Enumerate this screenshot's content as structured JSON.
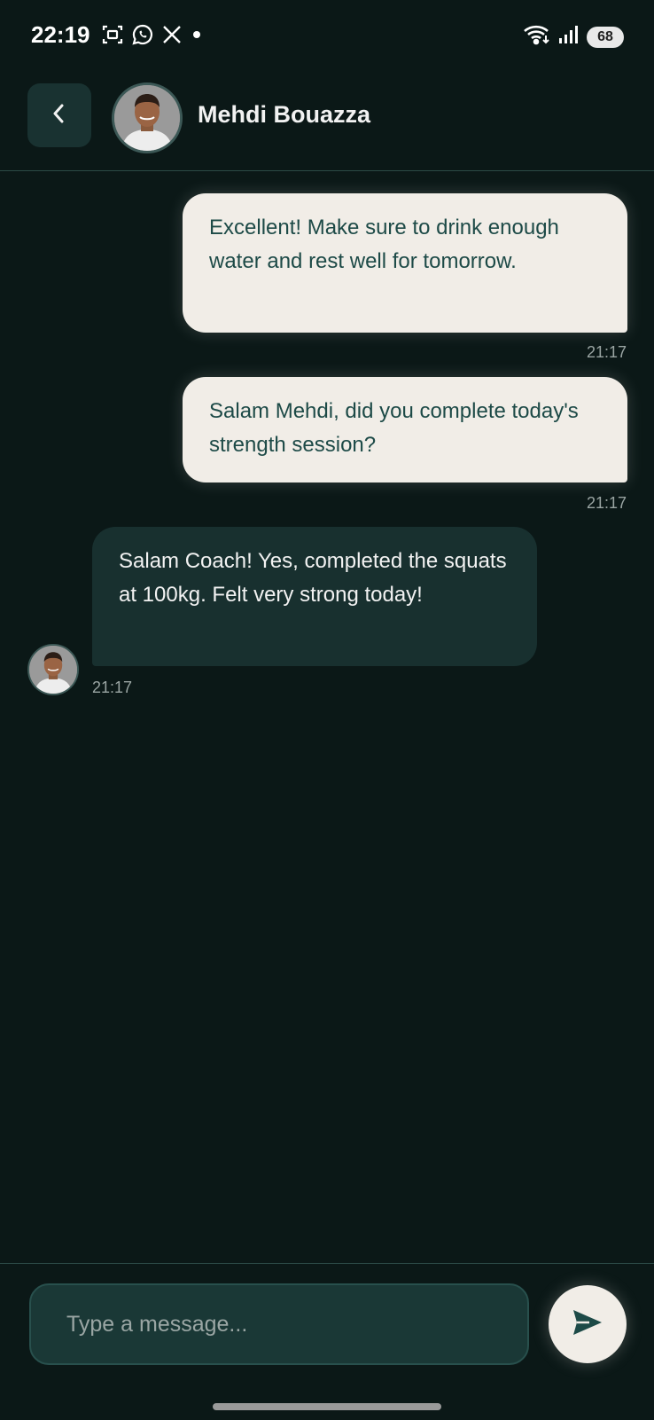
{
  "status_bar": {
    "time": "22:19",
    "notification_icons": [
      "screenshot-icon",
      "whatsapp-icon",
      "x-icon",
      "dot-icon"
    ],
    "system_icons": [
      "wifi-icon",
      "signal-icon"
    ],
    "battery": "68"
  },
  "header": {
    "back_icon": "chevron-left-icon",
    "contact_name": "Mehdi Bouazza"
  },
  "messages": [
    {
      "direction": "outgoing",
      "text": "Excellent! Make sure to drink enough water and rest well for tomorrow.",
      "time": "21:17"
    },
    {
      "direction": "outgoing",
      "text": "Salam Mehdi, did you complete today's strength session?",
      "time": "21:17"
    },
    {
      "direction": "incoming",
      "text": "Salam Coach! Yes, completed the squats at 100kg. Felt very strong today!",
      "time": "21:17"
    }
  ],
  "composer": {
    "placeholder": "Type a message...",
    "value": "",
    "send_icon": "send-icon"
  },
  "colors": {
    "background": "#0b1817",
    "outgoing_bubble": "#f1ede7",
    "outgoing_text": "#1d4a47",
    "incoming_bubble": "#18302f",
    "accent": "#1d4a47"
  }
}
